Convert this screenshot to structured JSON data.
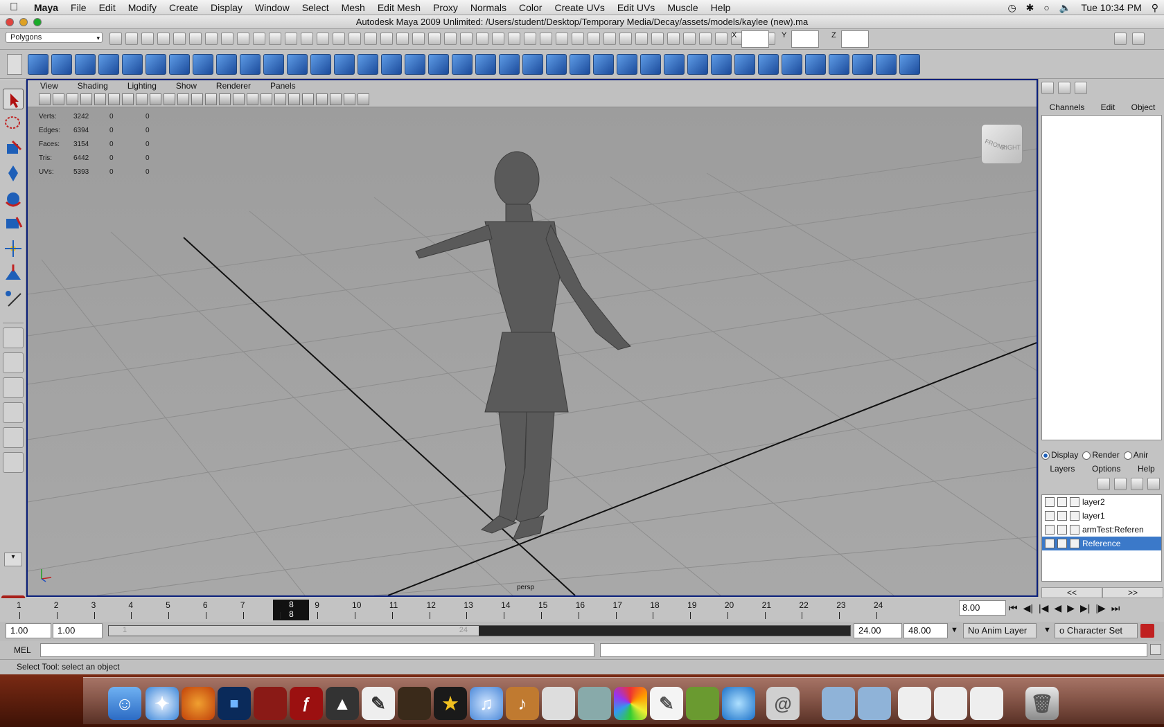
{
  "menubar": {
    "app": "Maya",
    "items": [
      "File",
      "Edit",
      "Modify",
      "Create",
      "Display",
      "Window",
      "Select",
      "Mesh",
      "Edit Mesh",
      "Proxy",
      "Normals",
      "Color",
      "Create UVs",
      "Edit UVs",
      "Muscle",
      "Help"
    ],
    "clock": "Tue 10:34 PM"
  },
  "window": {
    "title": "Autodesk Maya 2009 Unlimited: /Users/student/Desktop/Temporary Media/Decay/assets/models/kaylee (new).ma"
  },
  "statusline": {
    "mode": "Polygons",
    "x_label": "X",
    "y_label": "Y",
    "z_label": "Z"
  },
  "viewport": {
    "menus": [
      "View",
      "Shading",
      "Lighting",
      "Show",
      "Renderer",
      "Panels"
    ],
    "camera": "persp",
    "viewcube_front": "FRONT",
    "viewcube_right": "RIGHT",
    "hud": [
      {
        "label": "Verts:",
        "a": "3242",
        "b": "0",
        "c": "0"
      },
      {
        "label": "Edges:",
        "a": "6394",
        "b": "0",
        "c": "0"
      },
      {
        "label": "Faces:",
        "a": "3154",
        "b": "0",
        "c": "0"
      },
      {
        "label": "Tris:",
        "a": "6442",
        "b": "0",
        "c": "0"
      },
      {
        "label": "UVs:",
        "a": "5393",
        "b": "0",
        "c": "0"
      }
    ]
  },
  "channelbox": {
    "menus": [
      "Channels",
      "Edit",
      "Object"
    ]
  },
  "layers": {
    "radios": [
      "Display",
      "Render",
      "Anir"
    ],
    "menus": [
      "Layers",
      "Options",
      "Help"
    ],
    "rows": [
      "layer2",
      "layer1",
      "armTest:Referen",
      "Reference"
    ],
    "selected": "Reference",
    "nav_left": "<<",
    "nav_right": ">>"
  },
  "timeline": {
    "ticks": [
      "1",
      "2",
      "3",
      "4",
      "5",
      "6",
      "7",
      "8",
      "9",
      "10",
      "11",
      "12",
      "13",
      "14",
      "15",
      "16",
      "17",
      "18",
      "19",
      "20",
      "21",
      "22",
      "23",
      "24"
    ],
    "current": "8",
    "current_time": "8.00"
  },
  "range": {
    "start": "1.00",
    "start2": "1.00",
    "slider_start": "1",
    "slider_end": "24",
    "end": "24.00",
    "end2": "48.00",
    "anim_layer": "No Anim Layer",
    "char_set": "o Character Set"
  },
  "mel": {
    "label": "MEL"
  },
  "help": {
    "text": "Select Tool: select an object"
  },
  "colors": {
    "viewport_bg": "#a2a2a2",
    "selection": "#3b79c9",
    "panel": "#c3c3c3"
  }
}
